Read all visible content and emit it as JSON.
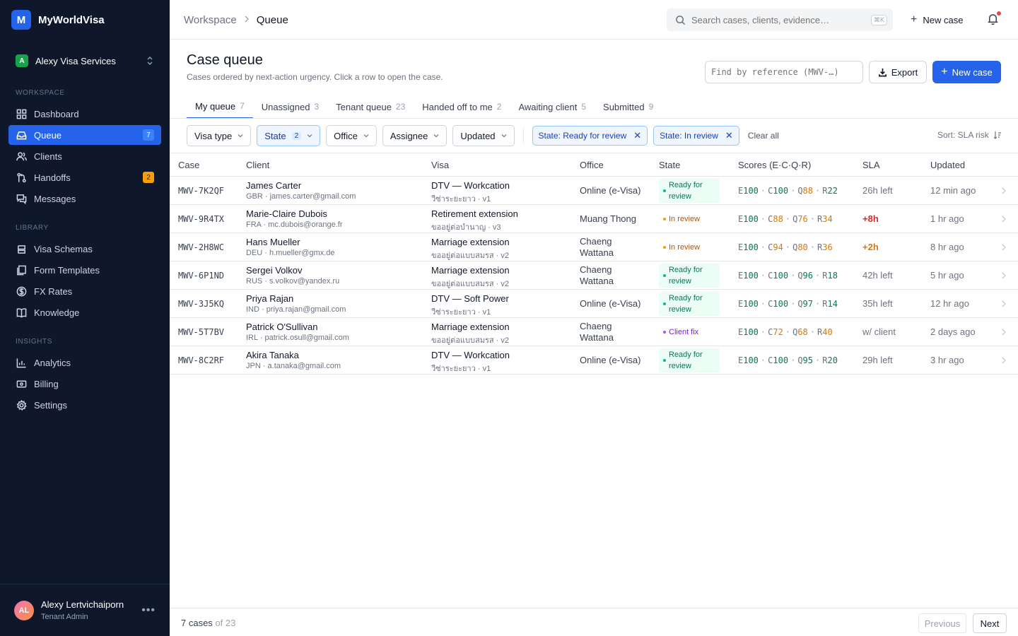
{
  "brand": {
    "logo_letter": "M",
    "name": "MyWorldVisa"
  },
  "tenant": {
    "badge": "A",
    "name": "Alexy Visa Services"
  },
  "sidebar": {
    "sections": [
      {
        "label": "WORKSPACE",
        "items": [
          {
            "label": "Dashboard",
            "icon": "dashboard-icon"
          },
          {
            "label": "Queue",
            "icon": "inbox-icon",
            "badge": "7"
          },
          {
            "label": "Clients",
            "icon": "users-icon"
          },
          {
            "label": "Handoffs",
            "icon": "handoff-icon",
            "badge": "2"
          },
          {
            "label": "Messages",
            "icon": "messages-icon"
          }
        ]
      },
      {
        "label": "LIBRARY",
        "items": [
          {
            "label": "Visa Schemas",
            "icon": "schema-icon"
          },
          {
            "label": "Form Templates",
            "icon": "template-icon"
          },
          {
            "label": "FX Rates",
            "icon": "currency-icon"
          },
          {
            "label": "Knowledge",
            "icon": "book-icon"
          }
        ]
      },
      {
        "label": "INSIGHTS",
        "items": [
          {
            "label": "Analytics",
            "icon": "chart-icon"
          },
          {
            "label": "Billing",
            "icon": "billing-icon"
          },
          {
            "label": "Settings",
            "icon": "gear-icon"
          }
        ]
      }
    ]
  },
  "user": {
    "initials": "AL",
    "name": "Alexy Lertvichaiporn",
    "role": "Tenant Admin",
    "more": "•••"
  },
  "topbar": {
    "crumb_1": "Workspace",
    "crumb_2": "Queue",
    "search_placeholder": "Search cases, clients, evidence…",
    "search_kbd": "⌘K",
    "new_case": "New case"
  },
  "header": {
    "title": "Case queue",
    "subtitle": "Cases ordered by next-action urgency. Click a row to open the case.",
    "find_placeholder": "Find by reference (MWV-…)",
    "export": "Export",
    "new_case": "New case"
  },
  "tabs": [
    {
      "label": "My queue",
      "count": "7",
      "active": true
    },
    {
      "label": "Unassigned",
      "count": "3"
    },
    {
      "label": "Tenant queue",
      "count": "23"
    },
    {
      "label": "Handed off to me",
      "count": "2"
    },
    {
      "label": "Awaiting client",
      "count": "5"
    },
    {
      "label": "Submitted",
      "count": "9"
    }
  ],
  "filters": {
    "visa_type": "Visa type",
    "state": "State",
    "state_count": "2",
    "office": "Office",
    "assignee": "Assignee",
    "updated": "Updated",
    "chip_1": "State: Ready for review",
    "chip_2": "State: In review",
    "clear_all": "Clear all",
    "sort": "Sort: SLA risk"
  },
  "columns": [
    "Case",
    "Client",
    "Visa",
    "Office",
    "State",
    "Scores (E·C·Q·R)",
    "SLA",
    "Updated"
  ],
  "colors": {
    "green": "#047857",
    "amber": "#d97706",
    "red": "#dc2626",
    "gray": "#6b7280"
  },
  "rows": [
    {
      "case": "MWV-7K2QF",
      "name": "James Carter",
      "client_sub": "GBR · james.carter@gmail.com",
      "visa": "DTV — Workcation",
      "visa_sub": "วีซ่าระยะยาว · v1",
      "office": "Online (e-Visa)",
      "state": "Ready for review",
      "state_kind": "ready",
      "scores": [
        [
          "E",
          "100",
          "green"
        ],
        [
          "C",
          "100",
          "green"
        ],
        [
          "Q",
          "88",
          "amber"
        ],
        [
          "R",
          "22",
          "green"
        ]
      ],
      "sla": "26h left",
      "sla_kind": "gray",
      "updated": "12 min ago"
    },
    {
      "case": "MWV-9R4TX",
      "name": "Marie-Claire Dubois",
      "client_sub": "FRA · mc.dubois@orange.fr",
      "visa": "Retirement extension",
      "visa_sub": "ขออยู่ต่อบำนาญ · v3",
      "office": "Muang Thong",
      "state": "In review",
      "state_kind": "review",
      "scores": [
        [
          "E",
          "100",
          "green"
        ],
        [
          "C",
          "88",
          "amber"
        ],
        [
          "Q",
          "76",
          "amber"
        ],
        [
          "R",
          "34",
          "amber"
        ]
      ],
      "sla": "+8h",
      "sla_kind": "red",
      "updated": "1 hr ago"
    },
    {
      "case": "MWV-2H8WC",
      "name": "Hans Mueller",
      "client_sub": "DEU · h.mueller@gmx.de",
      "visa": "Marriage extension",
      "visa_sub": "ขออยู่ต่อแบบสมรส · v2",
      "office": "Chaeng Wattana",
      "state": "In review",
      "state_kind": "review",
      "scores": [
        [
          "E",
          "100",
          "green"
        ],
        [
          "C",
          "94",
          "amber"
        ],
        [
          "Q",
          "80",
          "amber"
        ],
        [
          "R",
          "36",
          "amber"
        ]
      ],
      "sla": "+2h",
      "sla_kind": "amber",
      "updated": "8 hr ago"
    },
    {
      "case": "MWV-6P1ND",
      "name": "Sergei Volkov",
      "client_sub": "RUS · s.volkov@yandex.ru",
      "visa": "Marriage extension",
      "visa_sub": "ขออยู่ต่อแบบสมรส · v2",
      "office": "Chaeng Wattana",
      "state": "Ready for review",
      "state_kind": "ready",
      "scores": [
        [
          "E",
          "100",
          "green"
        ],
        [
          "C",
          "100",
          "green"
        ],
        [
          "Q",
          "96",
          "green"
        ],
        [
          "R",
          "18",
          "green"
        ]
      ],
      "sla": "42h left",
      "sla_kind": "gray",
      "updated": "5 hr ago"
    },
    {
      "case": "MWV-3J5KQ",
      "name": "Priya Rajan",
      "client_sub": "IND · priya.rajan@gmail.com",
      "visa": "DTV — Soft Power",
      "visa_sub": "วีซ่าระยะยาว · v1",
      "office": "Online (e-Visa)",
      "state": "Ready for review",
      "state_kind": "ready",
      "scores": [
        [
          "E",
          "100",
          "green"
        ],
        [
          "C",
          "100",
          "green"
        ],
        [
          "Q",
          "97",
          "green"
        ],
        [
          "R",
          "14",
          "green"
        ]
      ],
      "sla": "35h left",
      "sla_kind": "gray",
      "updated": "12 hr ago"
    },
    {
      "case": "MWV-5T7BV",
      "name": "Patrick O'Sullivan",
      "client_sub": "IRL · patrick.osull@gmail.com",
      "visa": "Marriage extension",
      "visa_sub": "ขออยู่ต่อแบบสมรส · v2",
      "office": "Chaeng Wattana",
      "state": "Client fix",
      "state_kind": "fix",
      "scores": [
        [
          "E",
          "100",
          "green"
        ],
        [
          "C",
          "72",
          "amber"
        ],
        [
          "Q",
          "68",
          "amber"
        ],
        [
          "R",
          "40",
          "amber"
        ]
      ],
      "sla": "w/ client",
      "sla_kind": "gray",
      "updated": "2 days ago"
    },
    {
      "case": "MWV-8C2RF",
      "name": "Akira Tanaka",
      "client_sub": "JPN · a.tanaka@gmail.com",
      "visa": "DTV — Workcation",
      "visa_sub": "วีซ่าระยะยาว · v1",
      "office": "Online (e-Visa)",
      "state": "Ready for review",
      "state_kind": "ready",
      "scores": [
        [
          "E",
          "100",
          "green"
        ],
        [
          "C",
          "100",
          "green"
        ],
        [
          "Q",
          "95",
          "green"
        ],
        [
          "R",
          "20",
          "green"
        ]
      ],
      "sla": "29h left",
      "sla_kind": "gray",
      "updated": "3 hr ago"
    }
  ],
  "footer": {
    "count": "7 cases",
    "of": "of 23",
    "previous": "Previous",
    "next": "Next"
  }
}
